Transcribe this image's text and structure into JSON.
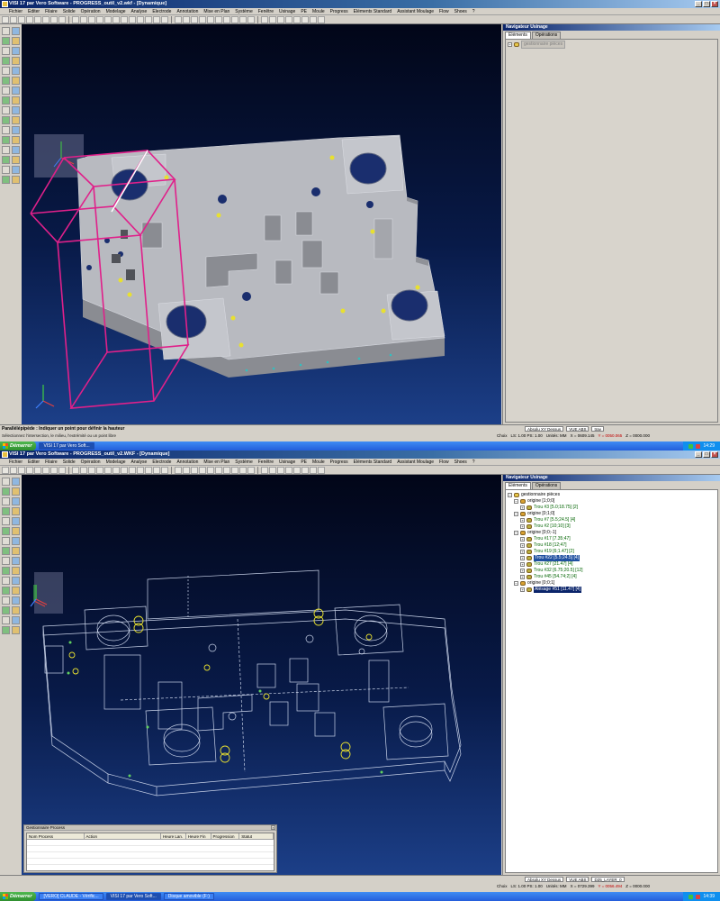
{
  "window": {
    "title_top": "VISI 17 par Vero Software - PROGRESS_outil_v2.wkf - [Dynamique]",
    "title_bottom": "VISI 17 par Vero Software - PROGRESS_outil_v2.WKF - [Dynamique]"
  },
  "menu": [
    "Fichier",
    "Editer",
    "Filaire",
    "Solide",
    "Opération",
    "Modelage",
    "Analyse",
    "Electrode",
    "Annotation",
    "Mise en Plan",
    "Système",
    "Fenêtre",
    "Usinage",
    "PE",
    "Moule",
    "Progress",
    "Eléments Standard",
    "Assistant Moulage",
    "Flow",
    "Shoes",
    "?"
  ],
  "panel": {
    "title": "Navigateur Usinage",
    "tab_elements": "Eléments",
    "tab_operations": "Opérations"
  },
  "tree_top": {
    "root_label": "gestionnaire pièces"
  },
  "tree_bottom": [
    {
      "level": 0,
      "icon": "folder",
      "label": "gestionnaire pièces",
      "style": ""
    },
    {
      "level": 1,
      "icon": "origin",
      "label": "origine [1;0;0]",
      "style": ""
    },
    {
      "level": 2,
      "icon": "hole",
      "label": "Trou #3 [5.0;18.75] [2]",
      "style": "green"
    },
    {
      "level": 1,
      "icon": "origin",
      "label": "origine [0;1;0]",
      "style": ""
    },
    {
      "level": 2,
      "icon": "hole",
      "label": "Trou #7 [5.5;24.5] [4]",
      "style": "green"
    },
    {
      "level": 2,
      "icon": "hole",
      "label": "Trou #2 [10;10] [3]",
      "style": "green"
    },
    {
      "level": 1,
      "icon": "origin",
      "label": "origine [0;0;-1]",
      "style": ""
    },
    {
      "level": 2,
      "icon": "hole",
      "label": "Trou #17 [7.35;47]",
      "style": "green"
    },
    {
      "level": 2,
      "icon": "hole",
      "label": "Trou #18 [12;47]",
      "style": "green"
    },
    {
      "level": 2,
      "icon": "hole",
      "label": "Trou #19 [6;1.47] [2]",
      "style": "green"
    },
    {
      "level": 2,
      "icon": "hole",
      "label": "Trou #22 [5.5;24.5] [4]",
      "style": "sel2"
    },
    {
      "level": 2,
      "icon": "hole",
      "label": "Trou #27 [21.47] [4]",
      "style": "green"
    },
    {
      "level": 2,
      "icon": "hole",
      "label": "Trou #32 [6.75;20.5] [12]",
      "style": "green"
    },
    {
      "level": 2,
      "icon": "hole",
      "label": "Trou #45 [54.74;2] [4]",
      "style": "green"
    },
    {
      "level": 1,
      "icon": "origin",
      "label": "origine [0;0;1]",
      "style": ""
    },
    {
      "level": 2,
      "icon": "hole",
      "label": "Alésage #51 [11.47] [4]",
      "style": "sel"
    }
  ],
  "status_top": {
    "prompt": "Parallélépipède : Indiquer un point pour définir la hauteur",
    "hint": "Sélectionnez l'intersection, le milieu, l'extrémité ou un point libre",
    "view_mode": "Absolu XY Dessus",
    "view_name": "VUE ABS",
    "layer": "trav",
    "choix": "Choix",
    "ls_ps": "LS: 1.00 PS: 1.00",
    "units": "Unités: MM",
    "coord_x": "X = 0609.145",
    "coord_y": "Y = 0050.065",
    "coord_z": "Z = 0000.000"
  },
  "status_bottom": {
    "view_mode": "Absolu XY Dessus",
    "view_name": "VUE ABS",
    "layer": "D25_LAYER_0",
    "choix": "Choix",
    "ls_ps": "LS: 1.00 PS: 1.00",
    "units": "Unités: MM",
    "coord_x": "X = 0729.399",
    "coord_y": "Y = 0056.494",
    "coord_z": "Z = 0000.000"
  },
  "taskbar_top": {
    "start": "Démarrer",
    "task1": "VISI 17 par Vero Soft...",
    "clock": "14:29"
  },
  "taskbar_bottom": {
    "start": "Démarrer",
    "task1": "[VERO] CLAUDE - Vérific...",
    "task2": "VISI 17 par Vero Soft...",
    "task3": "Disque amovible (F:)",
    "clock": "14:39"
  },
  "process_manager": {
    "title": "Gestionnaire Process",
    "columns": [
      "Nom Process",
      "Action",
      "Heure Lan.",
      "Heure Fin",
      "Progression",
      "Statut"
    ]
  },
  "colors": {
    "accent_title": "#0a246a",
    "selection_box": "#e0208a",
    "part_face": "#b4b6bc",
    "holes": "#1a2e6e",
    "wire": "#c8d2e8",
    "feature": "#e8e030"
  }
}
